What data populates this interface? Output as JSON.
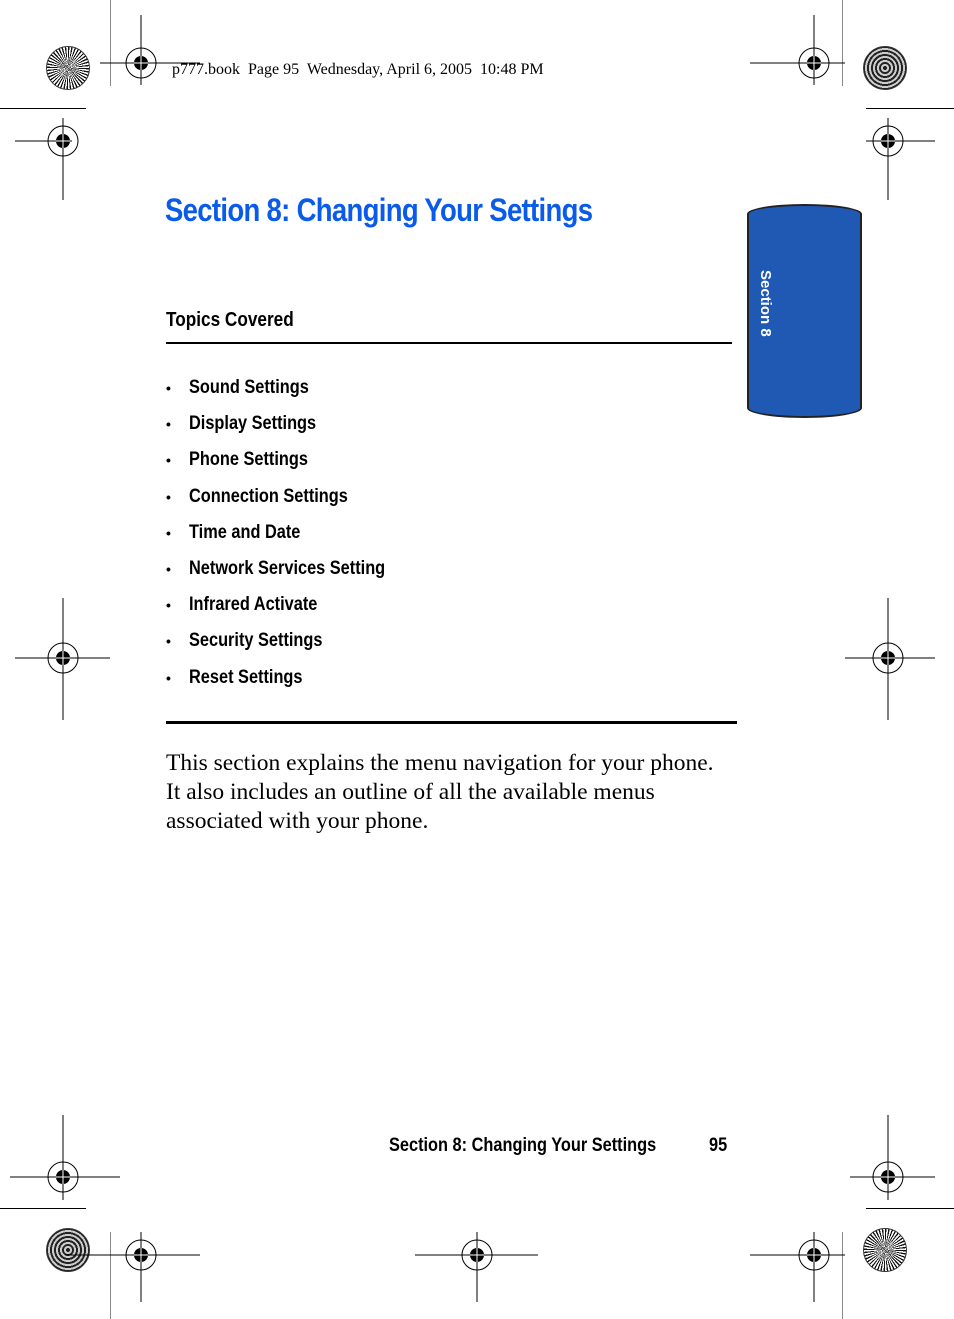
{
  "print_header": "p777.book  Page 95  Wednesday, April 6, 2005  10:48 PM",
  "section_tab": {
    "label": "Section 8",
    "color": "#1f59b4"
  },
  "page_title": "Section 8: Changing Your Settings",
  "title_color": "#0a5bea",
  "topics": {
    "heading": "Topics Covered",
    "bullet": "•",
    "items": [
      "Sound Settings",
      "Display Settings",
      "Phone Settings",
      "Connection Settings",
      "Time and Date",
      "Network Services Setting",
      "Infrared Activate",
      "Security Settings",
      "Reset Settings"
    ]
  },
  "intro_paragraph": "This section explains the menu navigation for your phone. It also includes an outline of all the available menus associated with your phone.",
  "footer": {
    "title": "Section 8: Changing Your Settings",
    "page_number": "95"
  }
}
